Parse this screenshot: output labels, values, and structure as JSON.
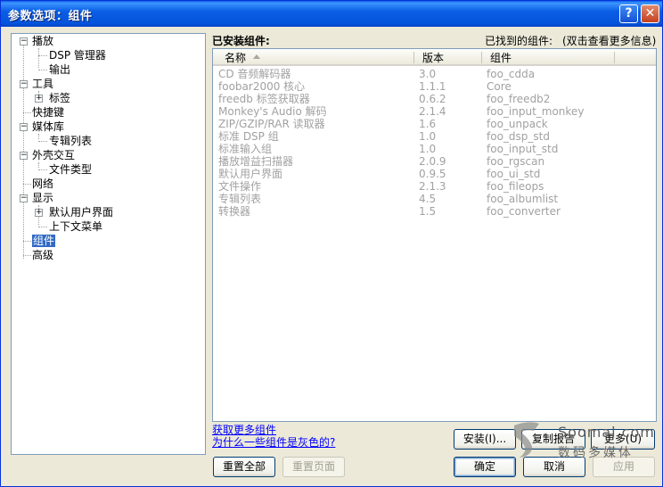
{
  "window": {
    "title": "参数选项：组件"
  },
  "titlebar": {
    "help_glyph": "?",
    "close_glyph": "✕"
  },
  "tree": {
    "items": [
      {
        "label": "播放",
        "expander": "−"
      },
      {
        "label": "DSP 管理器"
      },
      {
        "label": "输出"
      },
      {
        "label": "工具",
        "expander": "−"
      },
      {
        "label": "标签",
        "expander": "+"
      },
      {
        "label": "快捷键"
      },
      {
        "label": "媒体库",
        "expander": "−"
      },
      {
        "label": "专辑列表"
      },
      {
        "label": "外壳交互",
        "expander": "−"
      },
      {
        "label": "文件类型"
      },
      {
        "label": "网络"
      },
      {
        "label": "显示",
        "expander": "−"
      },
      {
        "label": "默认用户界面",
        "expander": "+"
      },
      {
        "label": "上下文菜单"
      },
      {
        "label": "组件",
        "selected": true
      },
      {
        "label": "高级"
      }
    ]
  },
  "panel": {
    "installed_label": "已安装组件:",
    "found_label": "已找到的组件:",
    "hint_label": "(双击查看更多信息)"
  },
  "list": {
    "columns": [
      "名称",
      "版本",
      "组件"
    ],
    "rows": [
      {
        "name": "CD 音频解码器",
        "version": "3.0",
        "module": "foo_cdda"
      },
      {
        "name": "foobar2000 核心",
        "version": "1.1.1",
        "module": "Core"
      },
      {
        "name": "freedb 标签获取器",
        "version": "0.6.2",
        "module": "foo_freedb2"
      },
      {
        "name": "Monkey's Audio 解码",
        "version": "2.1.4",
        "module": "foo_input_monkey"
      },
      {
        "name": "ZIP/GZIP/RAR 读取器",
        "version": "1.6",
        "module": "foo_unpack"
      },
      {
        "name": "标准 DSP 组",
        "version": "1.0",
        "module": "foo_dsp_std"
      },
      {
        "name": "标准输入组",
        "version": "1.0",
        "module": "foo_input_std"
      },
      {
        "name": "播放增益扫描器",
        "version": "2.0.9",
        "module": "foo_rgscan"
      },
      {
        "name": "默认用户界面",
        "version": "0.9.5",
        "module": "foo_ui_std"
      },
      {
        "name": "文件操作",
        "version": "2.1.3",
        "module": "foo_fileops"
      },
      {
        "name": "专辑列表",
        "version": "4.5",
        "module": "foo_albumlist"
      },
      {
        "name": "转换器",
        "version": "1.5",
        "module": "foo_converter"
      }
    ]
  },
  "links": {
    "get_more": "获取更多组件",
    "why_gray": "为什么一些组件是灰色的?"
  },
  "buttons": {
    "install": "安装(I)...",
    "copy_report": "复制报告",
    "more": "更多(U)",
    "reset_all": "重置全部",
    "reset_page": "重置页面",
    "ok": "确定",
    "cancel": "取消",
    "apply": "应用"
  },
  "watermark": {
    "text": "Soomal.com",
    "sub": "数码多媒体"
  },
  "colors": {
    "titlebar": "#0a5ee5",
    "selection": "#316ac5",
    "link": "#0000ff",
    "disabled_text": "#a1a1a1"
  }
}
